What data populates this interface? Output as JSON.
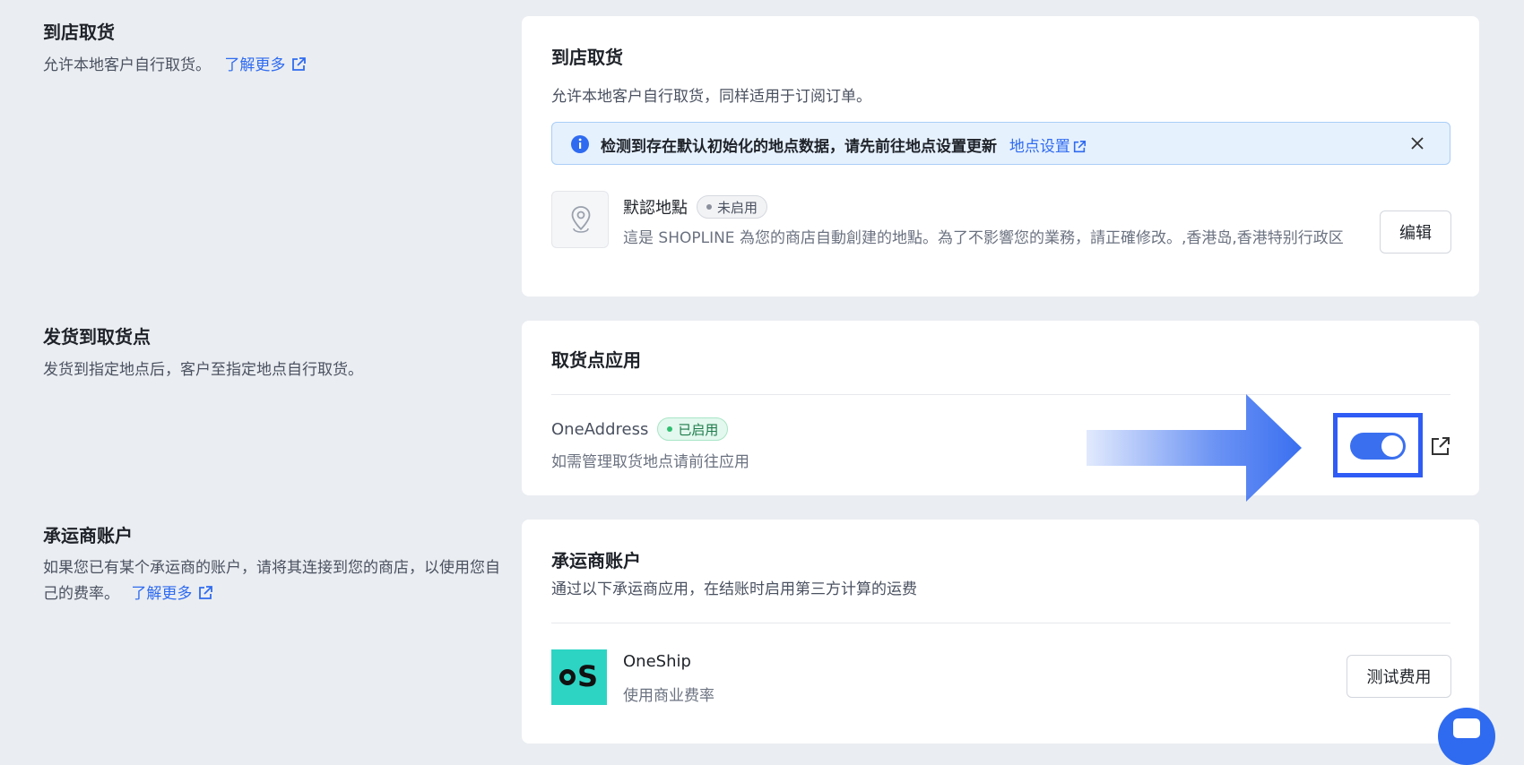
{
  "pickup": {
    "section_title": "到店取货",
    "section_desc": "允许本地客户自行取货。",
    "learn_more": "了解更多",
    "card_title": "到店取货",
    "card_desc": "允许本地客户自行取货，同样适用于订阅订单。",
    "alert_text": "检测到存在默认初始化的地点数据，请先前往地点设置更新",
    "alert_link": "地点设置",
    "location_name": "默認地點",
    "location_status": "未启用",
    "location_desc": "這是 SHOPLINE 為您的商店自動創建的地點。為了不影響您的業務，請正確修改。,香港岛,香港特别行政区",
    "edit_label": "编辑"
  },
  "ship_to_pickup": {
    "section_title": "发货到取货点",
    "section_desc": "发货到指定地点后，客户至指定地点自行取货。",
    "card_title": "取货点应用",
    "app_name": "OneAddress",
    "app_status": "已启用",
    "app_desc": "如需管理取货地点请前往应用",
    "toggle_on": true
  },
  "carrier": {
    "section_title": "承运商账户",
    "section_desc": "如果您已有某个承运商的账户，请将其连接到您的商店，以使用您自己的费率。",
    "learn_more": "了解更多",
    "card_title": "承运商账户",
    "card_desc": "通过以下承运商应用，在结账时启用第三方计算的运费",
    "app_name": "OneShip",
    "app_desc": "使用商业费率",
    "app_logo_text": "S",
    "test_label": "测试费用"
  },
  "colors": {
    "accent": "#2f6bf0",
    "toggle": "#3a6ff0",
    "highlight_box": "#2f5cf5",
    "oneship_logo": "#2dd4c4"
  },
  "icons": [
    "external-link-icon",
    "info-icon",
    "close-icon",
    "location-pin-icon",
    "arrow-annotation",
    "chat-icon"
  ]
}
